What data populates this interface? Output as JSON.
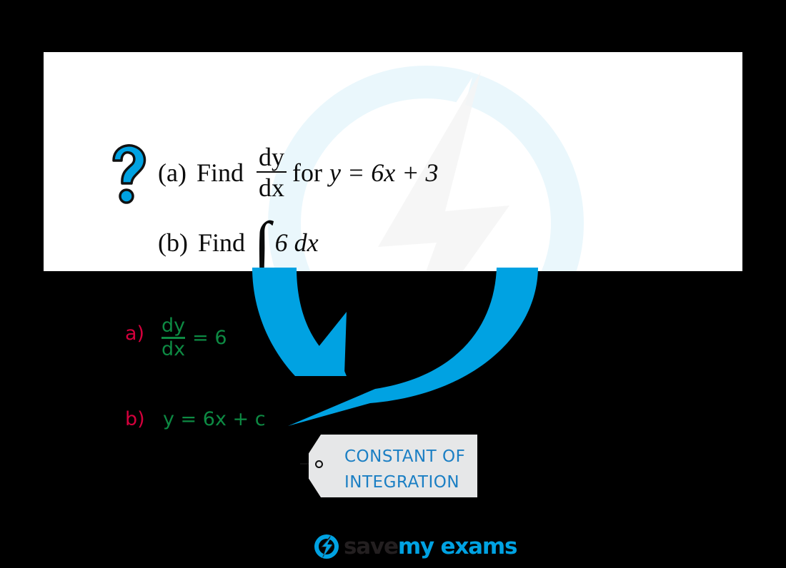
{
  "page": {
    "background_color": "#000000",
    "accent_blue": "#00A2E2",
    "answer_green": "#0D8A43",
    "label_red": "#D4003C",
    "tag_text_blue": "#1B7FC4",
    "card_background": "#FFFFFF"
  },
  "question_card": {
    "icon": "question-mark-icon",
    "watermark": "save-my-exams-watermark",
    "parts": [
      {
        "label": "(a)",
        "verb": "Find",
        "fraction": {
          "numerator": "dy",
          "denominator": "dx"
        },
        "connector": "for",
        "equation": "y = 6x + 3"
      },
      {
        "label": "(b)",
        "verb": "Find",
        "integral_symbol": "∫",
        "integrand": "6 dx"
      }
    ]
  },
  "answers": [
    {
      "label": "a)",
      "fraction": {
        "numerator": "dy",
        "denominator": "dx"
      },
      "result": "= 6"
    },
    {
      "label": "b)",
      "expression": "y = 6x + c"
    }
  ],
  "arrow": {
    "name": "curved-blue-arrow",
    "color": "#00A2E2"
  },
  "callout_tag": {
    "line1": "CONSTANT    OF",
    "line2": "INTEGRATION"
  },
  "footer": {
    "logo_icon": "lightning-bolt-circle-icon",
    "logo_text_dark": "save",
    "logo_text_blue": "my exams"
  }
}
